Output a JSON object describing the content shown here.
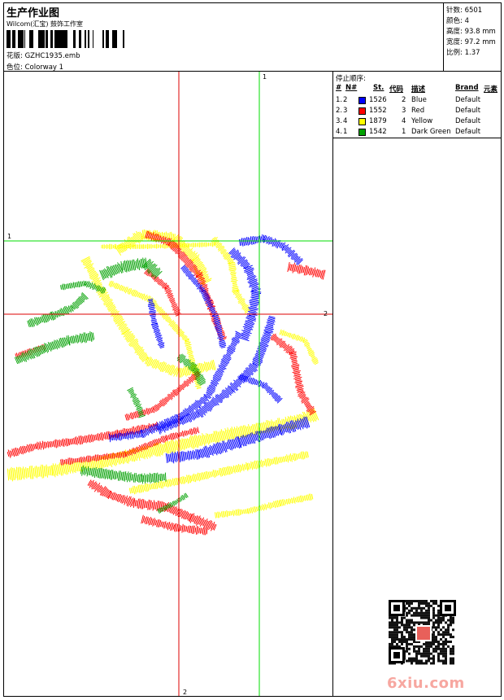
{
  "header": {
    "title": "生产作业图",
    "company": "Wilcom(汇宝) 鼓饰工作室",
    "design_label": "花版:",
    "design_file": "GZHC1935.emb",
    "colorway_label": "色位:",
    "colorway": "Colorway 1"
  },
  "stats": [
    {
      "label": "针数:",
      "value": "6501"
    },
    {
      "label": "颜色:",
      "value": "4"
    },
    {
      "label": "高度:",
      "value": "93.8 mm"
    },
    {
      "label": "宽度:",
      "value": "97.2 mm"
    },
    {
      "label": "比例:",
      "value": "1.37"
    }
  ],
  "sequence": {
    "title": "停止顺序:",
    "headers": {
      "num": "#",
      "no": "N#",
      "st": "St.",
      "code": "代码",
      "desc": "描述",
      "brand": "Brand",
      "elem": "元素"
    },
    "rows": [
      {
        "num": "1.",
        "no": "2",
        "color": "#0000ff",
        "st": "1526",
        "code": "2",
        "desc": "Blue",
        "brand": "Default"
      },
      {
        "num": "2.",
        "no": "3",
        "color": "#ff0000",
        "st": "1552",
        "code": "3",
        "desc": "Red",
        "brand": "Default"
      },
      {
        "num": "3.",
        "no": "4",
        "color": "#ffff00",
        "st": "1879",
        "code": "4",
        "desc": "Yellow",
        "brand": "Default"
      },
      {
        "num": "4.",
        "no": "1",
        "color": "#00a000",
        "st": "1542",
        "code": "1",
        "desc": "Dark Green",
        "brand": "Default"
      }
    ]
  },
  "guides": {
    "green_vertical_label": "1",
    "green_horizontal_label": "1",
    "red_horizontal_label": "2",
    "red_vertical_label": "2",
    "green_color": "#00dd00",
    "red_color": "#dd0000"
  },
  "palette": {
    "blue": "#0000ff",
    "red": "#ff0000",
    "yellow": "#ffff00",
    "green": "#00a000"
  },
  "watermark": "6xiu.com",
  "icons": {
    "qr": "qr-code-icon",
    "barcode": "barcode-icon"
  }
}
